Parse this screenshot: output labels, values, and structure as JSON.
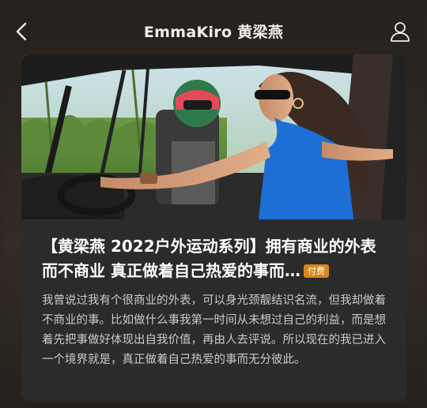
{
  "header": {
    "title": "EmmaKiro 黄梁燕",
    "back_icon": "chevron-left-icon",
    "profile_icon": "person-icon"
  },
  "article": {
    "image_alt": "photo-two-people-driving-off-road-buggy",
    "title": "【黄梁燕 2022户外运动系列】拥有商业的外表而不商业 真正做着自己热爱的事而…",
    "badge": "付费",
    "body": "我曾说过我有个很商业的外表，可以身光颈靓结识名流，但我却做着不商业的事。比如做什么事我第一时间从未想过自己的利益，而是想着先把事做好体现出自我价值，再由人去评说。所以现在的我已进入一个境界就是，真正做着自己热爱的事而无分彼此。"
  },
  "colors": {
    "card_bg": "#2b2b2b",
    "badge_bg": "#d9871f",
    "title_text": "#ffffff",
    "body_text": "#c9c9c9"
  }
}
